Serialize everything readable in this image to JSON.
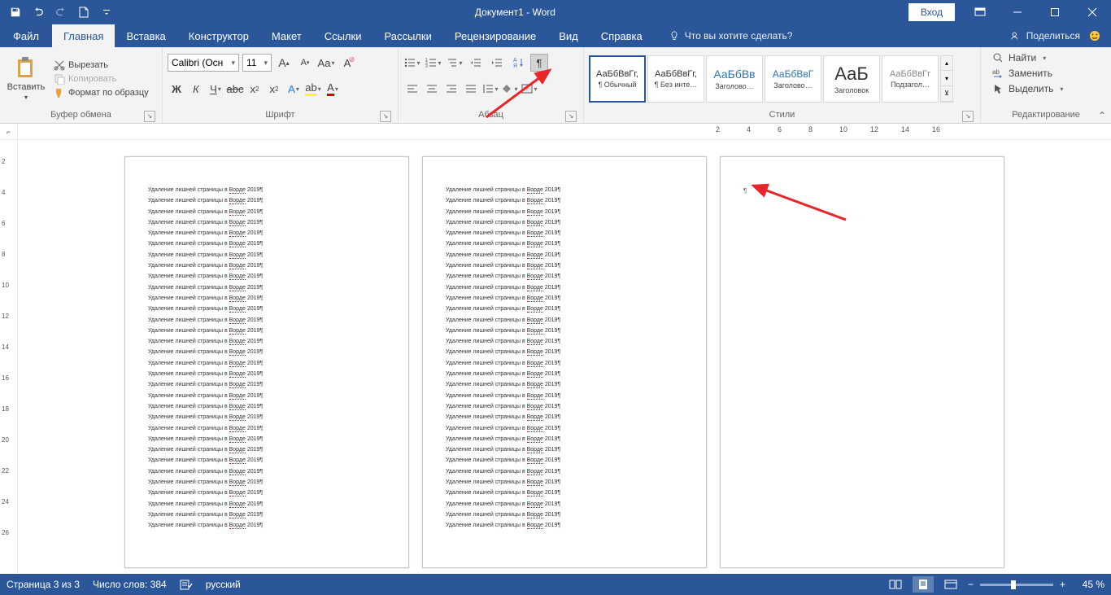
{
  "title": "Документ1  -  Word",
  "signin": "Вход",
  "tabs": {
    "file": "Файл",
    "home": "Главная",
    "insert": "Вставка",
    "design": "Конструктор",
    "layout": "Макет",
    "references": "Ссылки",
    "mailings": "Рассылки",
    "review": "Рецензирование",
    "view": "Вид",
    "help": "Справка",
    "tell_me": "Что вы хотите сделать?",
    "share": "Поделиться"
  },
  "clipboard": {
    "paste": "Вставить",
    "cut": "Вырезать",
    "copy": "Копировать",
    "format_painter": "Формат по образцу",
    "group_label": "Буфер обмена"
  },
  "font": {
    "name": "Calibri (Осн",
    "size": "11",
    "group_label": "Шрифт"
  },
  "paragraph": {
    "group_label": "Абзац"
  },
  "styles": {
    "group_label": "Стили",
    "items": [
      {
        "sample": "АаБбВвГг,",
        "name": "¶ Обычный",
        "color": "#333",
        "font_size": "11px"
      },
      {
        "sample": "АаБбВвГг,",
        "name": "¶ Без инте…",
        "color": "#333",
        "font_size": "11px"
      },
      {
        "sample": "АаБбВв",
        "name": "Заголово…",
        "color": "#2e74b5",
        "font_size": "14px"
      },
      {
        "sample": "АаБбВвГ",
        "name": "Заголово…",
        "color": "#2e74b5",
        "font_size": "12px"
      },
      {
        "sample": "АаБ",
        "name": "Заголовок",
        "color": "#333",
        "font_size": "22px"
      },
      {
        "sample": "АаБбВвГг",
        "name": "Подзагол…",
        "color": "#888",
        "font_size": "11px"
      }
    ]
  },
  "editing": {
    "find": "Найти",
    "replace": "Заменить",
    "select": "Выделить",
    "group_label": "Редактирование"
  },
  "document": {
    "line_text_prefix": "Удаление лишней страницы в ",
    "line_text_err": "Ворде",
    "line_text_suffix": " 2019¶",
    "lines_per_page": 32
  },
  "ruler": {
    "h_ticks": [
      "2",
      "4",
      "6",
      "8",
      "10",
      "12",
      "14",
      "16"
    ],
    "v_ticks": [
      "2",
      "4",
      "6",
      "8",
      "10",
      "12",
      "14",
      "16",
      "18",
      "20",
      "22",
      "24",
      "26"
    ]
  },
  "status": {
    "page": "Страница 3 из 3",
    "words": "Число слов: 384",
    "language": "русский",
    "zoom": "45 %"
  }
}
